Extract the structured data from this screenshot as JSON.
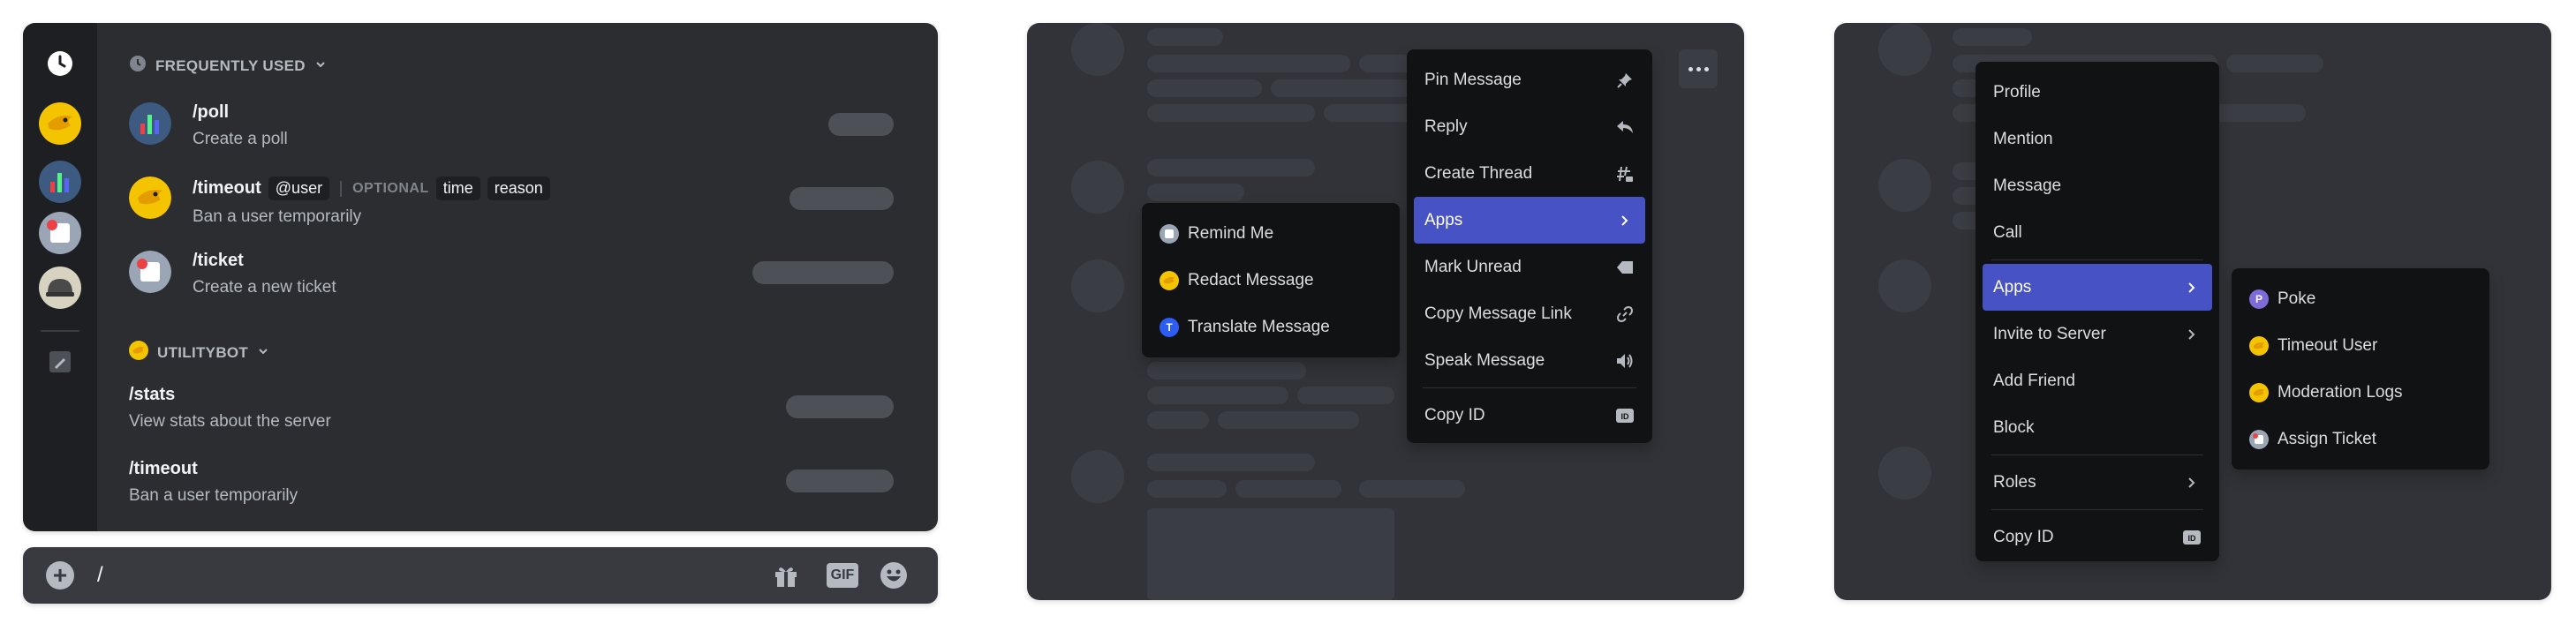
{
  "command_picker": {
    "frequently_used": {
      "header": "FREQUENTLY USED",
      "commands": [
        {
          "name": "/poll",
          "description": "Create a poll"
        },
        {
          "name": "/timeout",
          "description": "Ban a user temporarily",
          "required_option": "@user",
          "optional_label": "OPTIONAL",
          "optional_params": [
            "time",
            "reason"
          ]
        },
        {
          "name": "/ticket",
          "description": "Create a new ticket"
        }
      ]
    },
    "utilitybot": {
      "header": "UTILITYBOT",
      "commands": [
        {
          "name": "/stats",
          "description": "View stats about the server"
        },
        {
          "name": "/timeout",
          "description": "Ban a user temporarily"
        }
      ]
    },
    "input": {
      "value": "/"
    },
    "tools": {
      "gif_label": "GIF"
    }
  },
  "message_menu": {
    "items": [
      {
        "label": "Pin Message",
        "icon": "pin-icon"
      },
      {
        "label": "Reply",
        "icon": "reply-icon"
      },
      {
        "label": "Create Thread",
        "icon": "thread-icon"
      },
      {
        "label": "Apps",
        "icon": "chevron-right-icon",
        "active": true
      },
      {
        "label": "Mark Unread",
        "icon": "mark-unread-icon"
      },
      {
        "label": "Copy Message Link",
        "icon": "link-icon"
      },
      {
        "label": "Speak Message",
        "icon": "speaker-icon"
      },
      {
        "label": "Copy ID",
        "icon": "id-icon"
      }
    ],
    "apps_submenu": [
      {
        "label": "Remind Me",
        "icon": "remind-bot-icon"
      },
      {
        "label": "Redact Message",
        "icon": "bird-bot-icon"
      },
      {
        "label": "Translate Message",
        "icon": "translate-bot-icon",
        "icon_letter": "T"
      }
    ]
  },
  "user_menu": {
    "items": [
      {
        "label": "Profile"
      },
      {
        "label": "Mention"
      },
      {
        "label": "Message"
      },
      {
        "label": "Call"
      },
      {
        "label": "Apps",
        "active": true,
        "submenu": true
      },
      {
        "label": "Invite to Server",
        "submenu": true
      },
      {
        "label": "Add Friend"
      },
      {
        "label": "Block"
      },
      {
        "label": "Roles",
        "submenu": true
      },
      {
        "label": "Copy ID"
      }
    ],
    "apps_submenu": [
      {
        "label": "Poke",
        "icon": "poke-bot-icon",
        "icon_letter": "P"
      },
      {
        "label": "Timeout User",
        "icon": "bird-bot-icon"
      },
      {
        "label": "Moderation Logs",
        "icon": "bird-bot-icon"
      },
      {
        "label": "Assign Ticket",
        "icon": "ticket-bot-icon"
      }
    ]
  },
  "colors": {
    "accent": "#4752c4",
    "menu_bg": "#111214",
    "panel_bg": "#2b2d31",
    "bird": "#f5c400"
  }
}
